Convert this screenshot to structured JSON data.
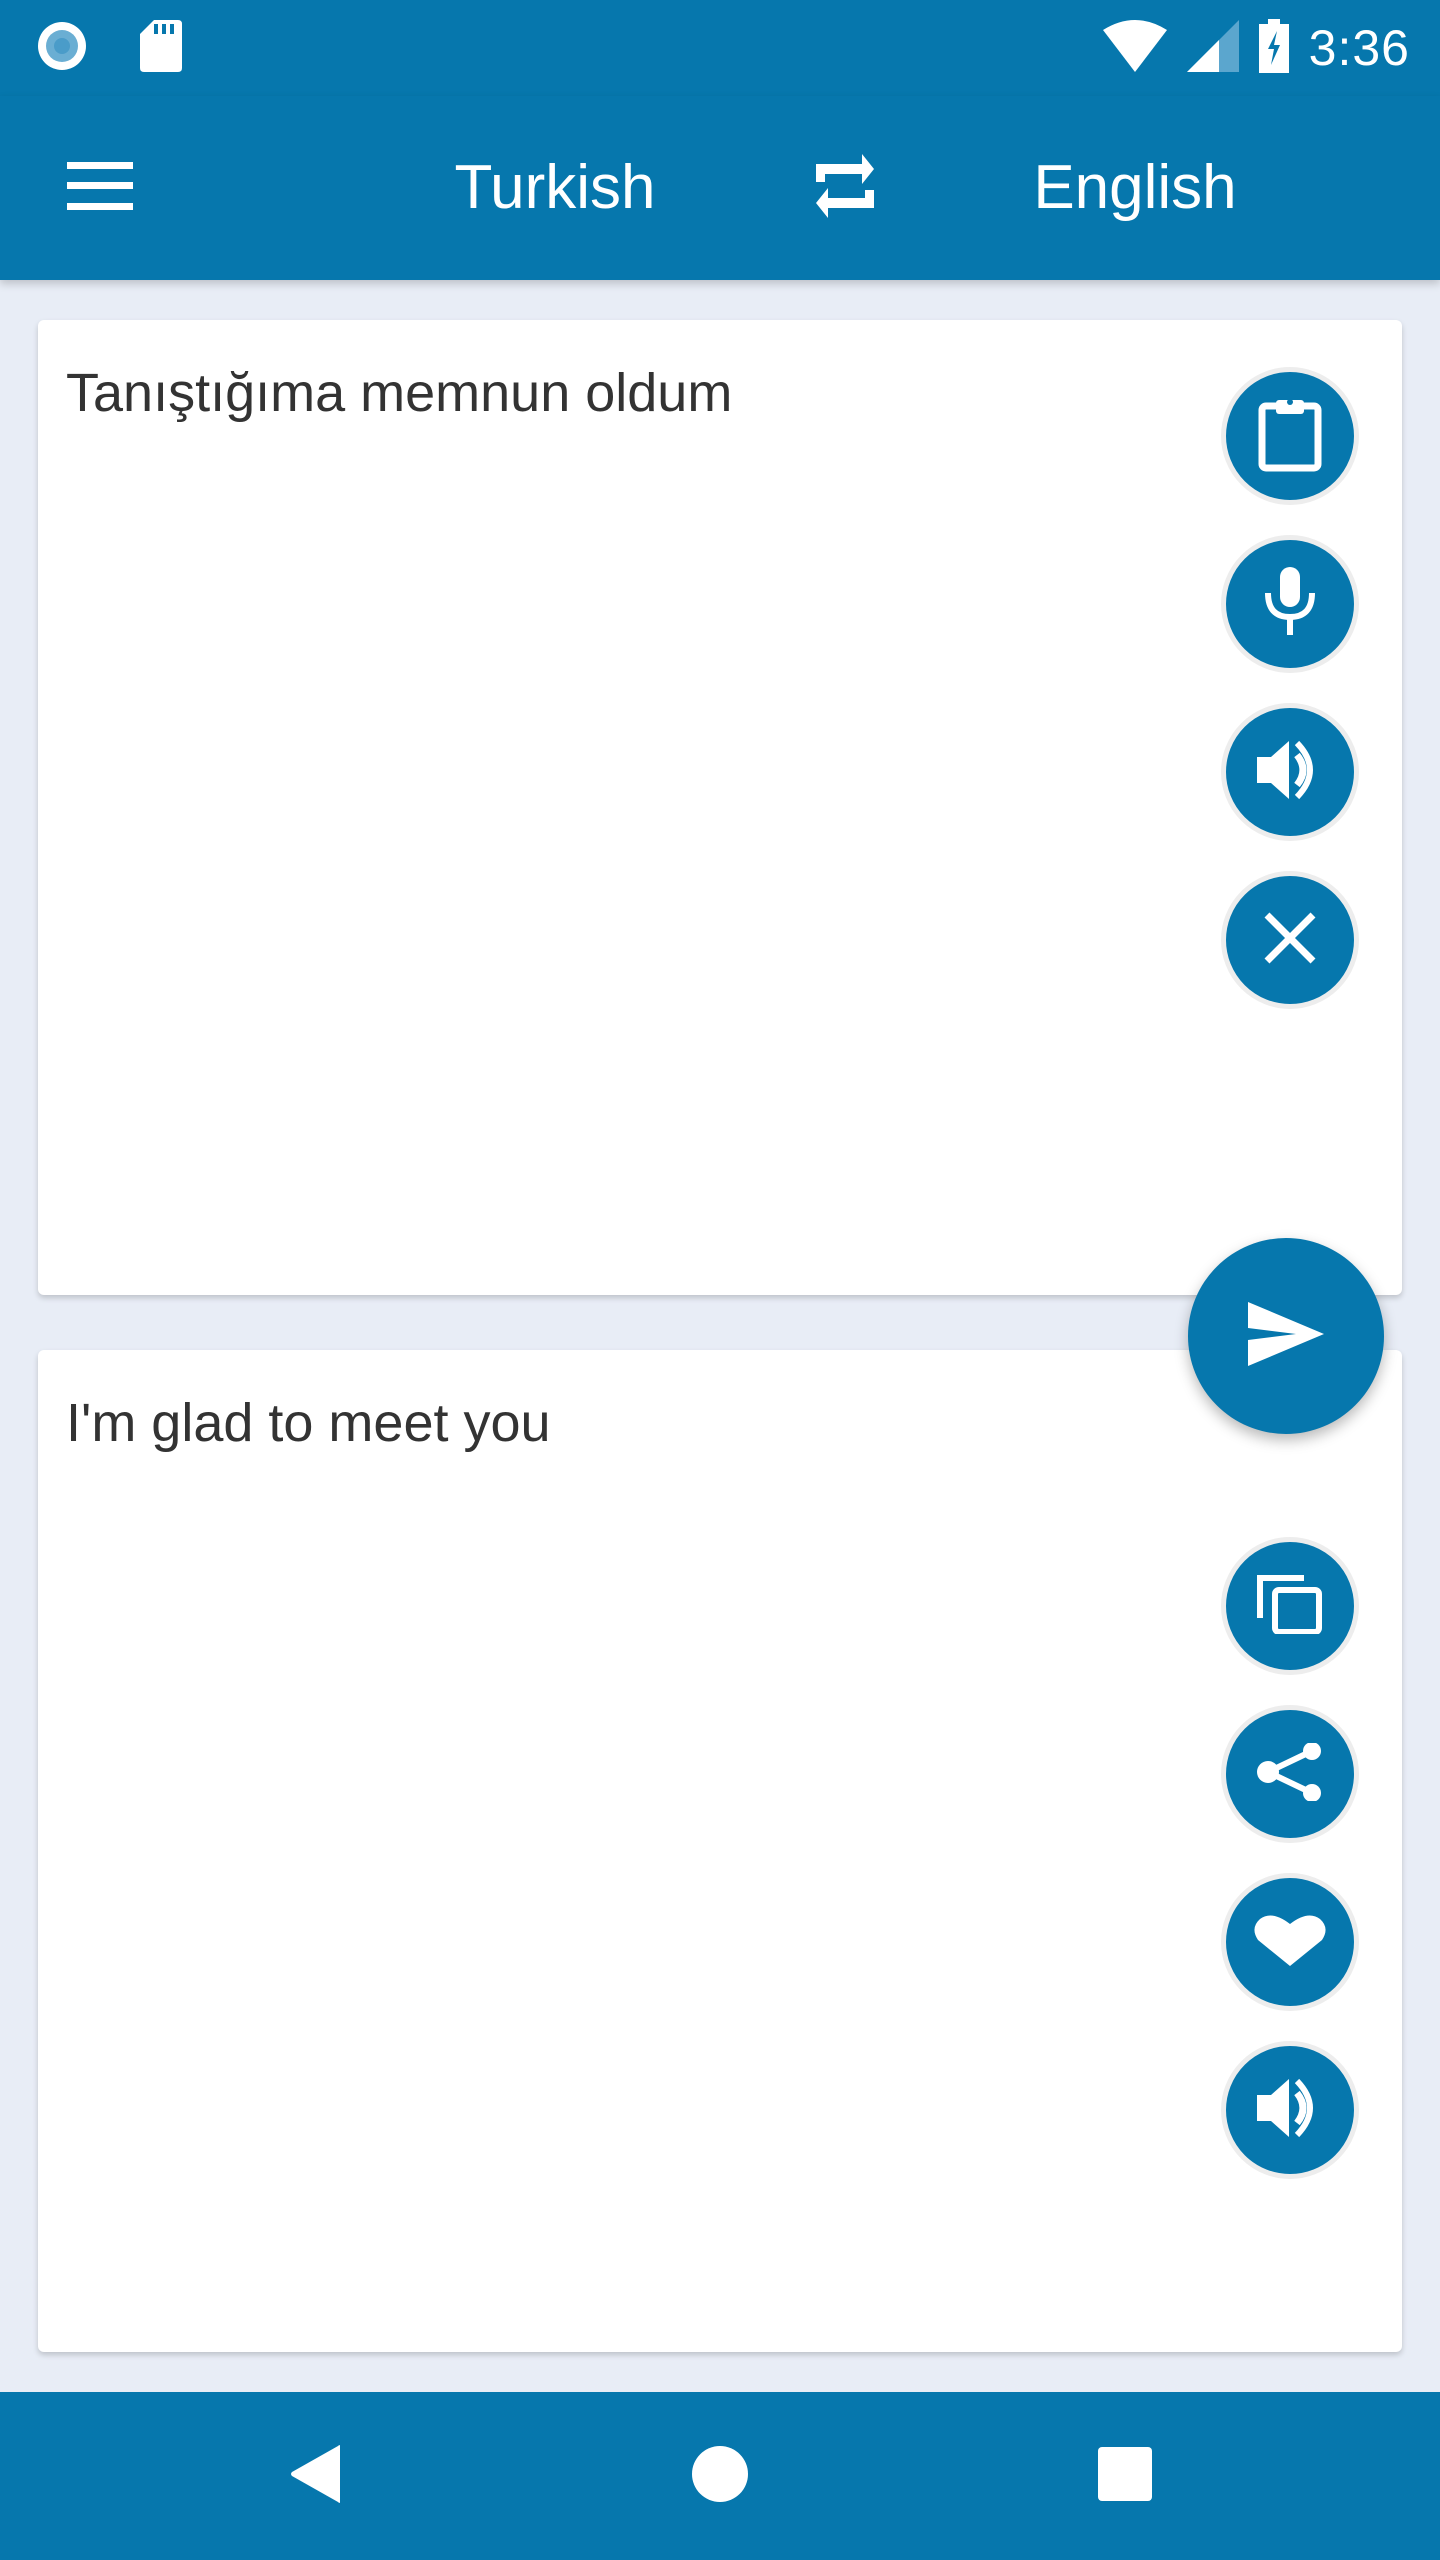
{
  "status_bar": {
    "time": "3:36",
    "left_icons": [
      "record-indicator-icon",
      "sd-card-icon"
    ],
    "right_icons": [
      "wifi-icon",
      "cell-signal-icon",
      "battery-charging-icon"
    ]
  },
  "app_bar": {
    "menu_icon": "hamburger-menu-icon",
    "source_language": "Turkish",
    "swap_icon": "swap-languages-icon",
    "target_language": "English"
  },
  "input_card": {
    "text": "Tanıştığıma memnun oldum",
    "actions": [
      {
        "name": "paste",
        "icon": "clipboard-icon"
      },
      {
        "name": "voice-input",
        "icon": "microphone-icon"
      },
      {
        "name": "speak-source",
        "icon": "speaker-icon"
      },
      {
        "name": "clear",
        "icon": "close-icon"
      }
    ]
  },
  "translate_button": {
    "icon": "send-icon"
  },
  "output_card": {
    "text": "I'm glad to meet you",
    "actions": [
      {
        "name": "copy",
        "icon": "copy-icon"
      },
      {
        "name": "share",
        "icon": "share-icon"
      },
      {
        "name": "favorite",
        "icon": "heart-icon"
      },
      {
        "name": "speak-translation",
        "icon": "speaker-icon"
      }
    ]
  },
  "nav_bar": {
    "buttons": [
      "back-icon",
      "home-icon",
      "recents-icon"
    ]
  },
  "colors": {
    "primary": "#0677AD",
    "background": "#E8EDF6",
    "card": "#FFFFFF",
    "text": "#333333"
  }
}
